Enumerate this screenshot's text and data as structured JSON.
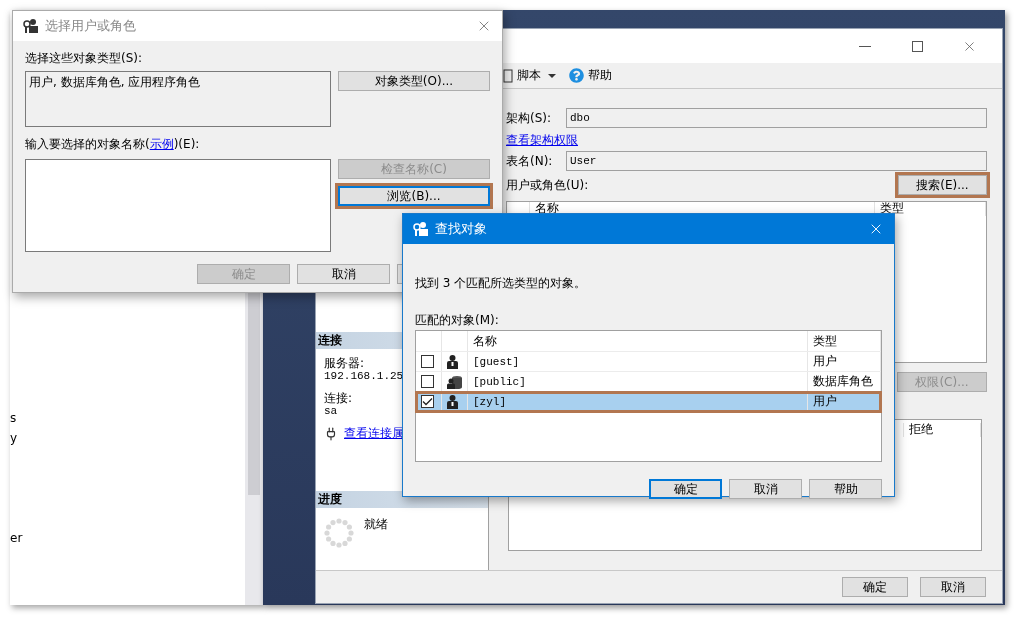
{
  "explorer": {
    "texts": [
      "s",
      "y",
      "er"
    ]
  },
  "permissions_dialog": {
    "active": false,
    "toolbar": [
      {
        "kind": "script",
        "label": "脚本"
      },
      {
        "kind": "help",
        "label": "帮助"
      }
    ],
    "schema": {
      "label": "架构(S):",
      "value": "dbo"
    },
    "schema_link": "查看架构权限",
    "table_name": {
      "label": "表名(N):",
      "value": "User"
    },
    "principals_label": "用户或角色(U):",
    "search_button": {
      "label": "搜索(E)...",
      "annotated": true
    },
    "principals_columns": [
      "名称",
      "类型"
    ],
    "permissions_button": {
      "label": "权限(C)...",
      "disabled": true
    },
    "permissions_columns": [
      "拒绝"
    ],
    "connection": {
      "heading": "连接",
      "server_label": "服务器:",
      "server": "192.168.1.25",
      "login_label": "连接:",
      "login": "sa",
      "link": "查看连接属"
    },
    "progress": {
      "heading": "进度",
      "status": "就绪"
    },
    "buttons": [
      "确定",
      "取消"
    ]
  },
  "select_dialog": {
    "title": "选择用户或角色",
    "active": false,
    "types_label": "选择这些对象类型(S):",
    "types": "用户, 数据库角色, 应用程序角色",
    "types_button": "对象类型(O)...",
    "names_label_start": "输入要选择的对象名称(",
    "names_label_link": "示例",
    "names_label_end": ")(E):",
    "side_buttons": [
      {
        "label": "检查名称(C)",
        "disabled": true,
        "focused": false,
        "annotated": false
      },
      {
        "label": "浏览(B)...",
        "disabled": false,
        "focused": true,
        "annotated": true
      }
    ],
    "buttons": [
      {
        "label": "确定",
        "disabled": true
      },
      {
        "label": "取消",
        "disabled": false
      }
    ]
  },
  "find_dialog": {
    "title": "查找对象",
    "active": true,
    "message": "找到 3 个匹配所选类型的对象。",
    "list_label": "匹配的对象(M):",
    "columns": [
      "名称",
      "类型"
    ],
    "rows": [
      {
        "kind": "user",
        "name": "[guest]",
        "type": "用户",
        "checked": false,
        "selected": false,
        "annotated": false
      },
      {
        "kind": "role",
        "name": "[public]",
        "type": "数据库角色",
        "checked": false,
        "selected": false,
        "annotated": false
      },
      {
        "kind": "user",
        "name": "[zyl]",
        "type": "用户",
        "checked": true,
        "selected": true,
        "annotated": true
      }
    ],
    "buttons": [
      {
        "label": "确定",
        "default": true
      },
      {
        "label": "取消",
        "default": false
      },
      {
        "label": "帮助",
        "default": false
      }
    ]
  }
}
